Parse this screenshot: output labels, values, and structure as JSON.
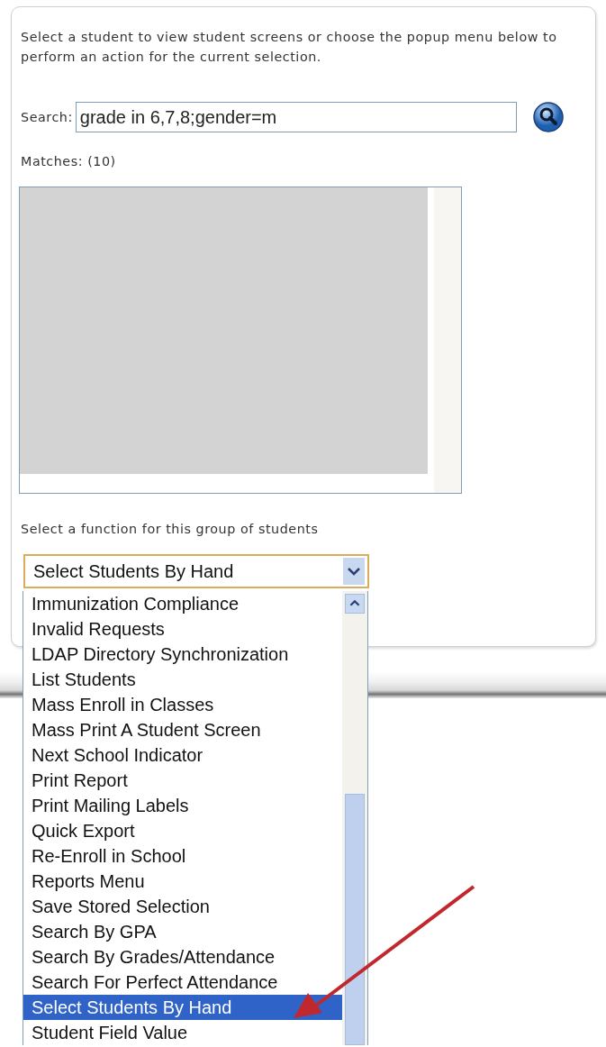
{
  "instructions": "Select a student to view student screens or choose the popup menu below to perform an action for the current selection.",
  "search": {
    "label": "Search:",
    "value": "grade in 6,7,8;gender=m"
  },
  "matches": "Matches: (10)",
  "function_label": "Select a function for this group of students",
  "function_select": {
    "value": "Select Students By Hand",
    "expanded": true,
    "options": [
      {
        "label": "Immunization Compliance",
        "selected": false
      },
      {
        "label": "Invalid Requests",
        "selected": false
      },
      {
        "label": "LDAP Directory Synchronization",
        "selected": false
      },
      {
        "label": "List Students",
        "selected": false
      },
      {
        "label": "Mass Enroll in Classes",
        "selected": false
      },
      {
        "label": "Mass Print A Student Screen",
        "selected": false
      },
      {
        "label": "Next School Indicator",
        "selected": false
      },
      {
        "label": "Print Report",
        "selected": false
      },
      {
        "label": "Print Mailing Labels",
        "selected": false
      },
      {
        "label": "Quick Export",
        "selected": false
      },
      {
        "label": "Re-Enroll in School",
        "selected": false
      },
      {
        "label": "Reports Menu",
        "selected": false
      },
      {
        "label": "Save Stored Selection",
        "selected": false
      },
      {
        "label": "Search By GPA",
        "selected": false
      },
      {
        "label": "Search By Grades/Attendance",
        "selected": false
      },
      {
        "label": "Search For Perfect Attendance",
        "selected": false
      },
      {
        "label": "Select Students By Hand",
        "selected": true
      },
      {
        "label": "Student Field Value",
        "selected": false
      }
    ]
  }
}
